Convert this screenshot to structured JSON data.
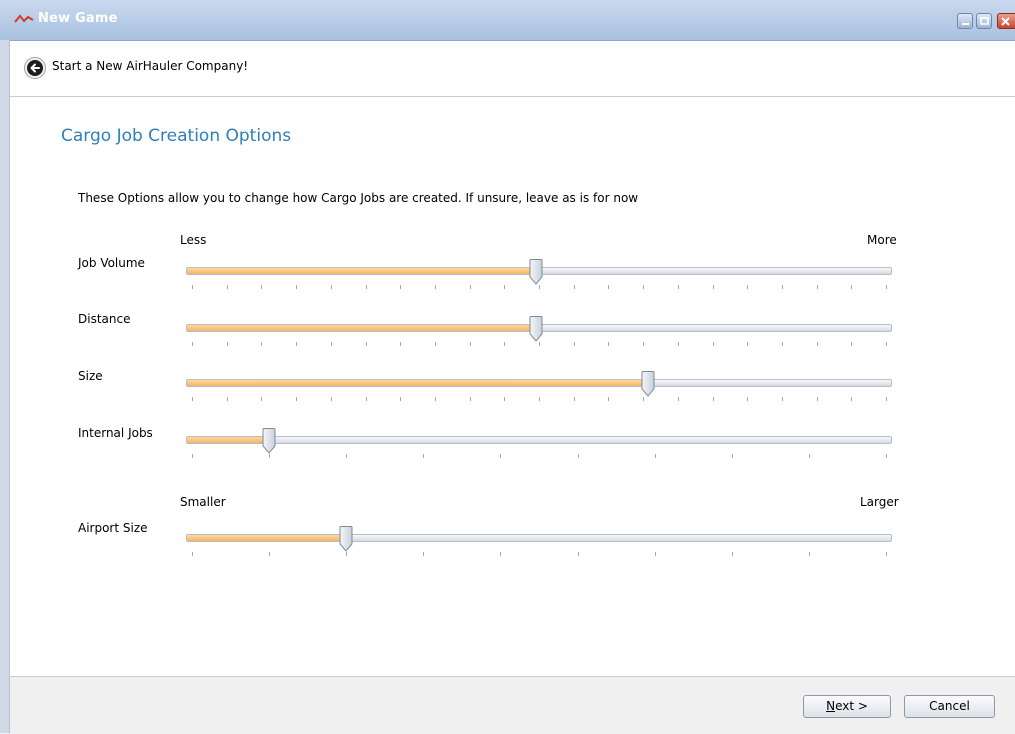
{
  "window": {
    "title": "New Game",
    "buttons": {
      "minimize_icon": "minimize-icon",
      "maximize_icon": "maximize-icon",
      "close_icon": "close-icon"
    }
  },
  "header": {
    "back_icon": "back-arrow-icon",
    "title": "Start a New AirHauler Company!"
  },
  "main": {
    "section_title": "Cargo Job Creation Options",
    "intro": "These Options allow you to change how Cargo Jobs are created.  If unsure, leave as is for now",
    "scale1": {
      "min_label": "Less",
      "max_label": "More"
    },
    "scale2": {
      "min_label": "Smaller",
      "max_label": "Larger"
    },
    "sliders": [
      {
        "label": "Job Volume",
        "value": 0.496,
        "ticks": 21
      },
      {
        "label": "Distance",
        "value": 0.496,
        "ticks": 21
      },
      {
        "label": "Size",
        "value": 0.654,
        "ticks": 21
      },
      {
        "label": "Internal Jobs",
        "value": 0.118,
        "ticks": 10
      },
      {
        "label": "Airport Size",
        "value": 0.227,
        "ticks": 10
      }
    ]
  },
  "footer": {
    "next_mnemonic": "N",
    "next_rest": "ext >",
    "cancel_label": "Cancel"
  },
  "colors": {
    "accent_title": "#2f80b9",
    "slider_fill": "#f6b462"
  }
}
